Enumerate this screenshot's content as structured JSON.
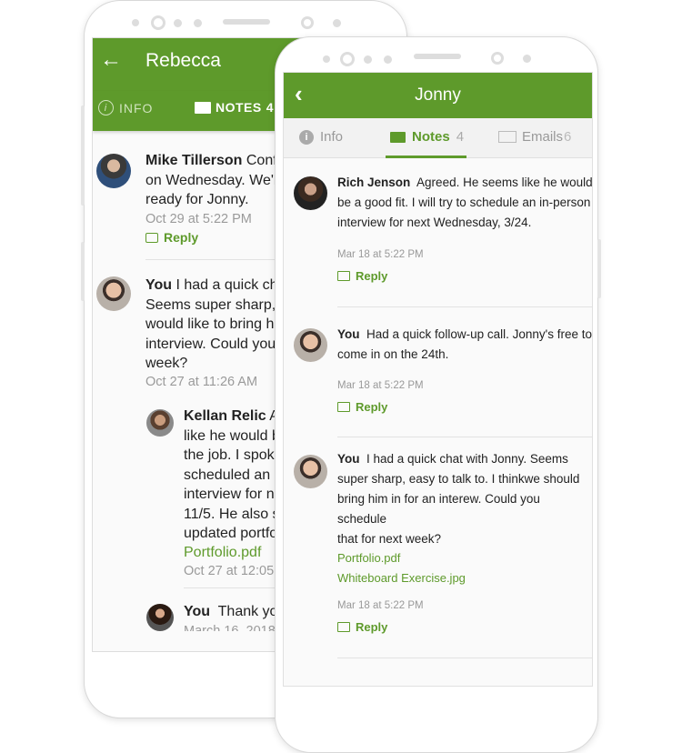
{
  "back_phone": {
    "header": {
      "title": "Rebecca",
      "back_icon": "arrow-left-icon"
    },
    "tabs": [
      {
        "label": "INFO",
        "icon": "info-icon"
      },
      {
        "label": "NOTES",
        "count": "4",
        "icon": "comment-icon",
        "active": true
      }
    ],
    "notes": [
      {
        "author": "Mike Tillerson",
        "lines": [
          "Confi",
          "on Wednesday. We'l",
          "ready for Jonny."
        ],
        "time": "Oct 29 at 5:22 PM",
        "reply": "Reply"
      },
      {
        "author": "You",
        "lines": [
          "I had a quick ch",
          "Seems super sharp,",
          "would like to bring h",
          "interview. Could you",
          "week?"
        ],
        "time": "Oct 27 at 11:26 AM"
      },
      {
        "author": "Kellan Relic",
        "lines": [
          "Ag",
          "like he would b",
          "the job. I spoke",
          "scheduled an i",
          "interview for ne",
          "11/5. He also s",
          "updated portfo"
        ],
        "attachment": "Portfolio.pdf",
        "time": "Oct 27 at 12:05 P"
      },
      {
        "author": "You",
        "lines": [
          "Thank you"
        ],
        "time": "March 16, 2018"
      }
    ]
  },
  "front_phone": {
    "header": {
      "title": "Jonny",
      "back_icon": "chevron-left-icon"
    },
    "tabs": [
      {
        "label": "Info",
        "icon": "info-icon"
      },
      {
        "label": "Notes",
        "count": "4",
        "icon": "comment-icon",
        "active": true
      },
      {
        "label": "Emails",
        "count": "6",
        "icon": "envelope-icon"
      }
    ],
    "notes": [
      {
        "author": "Rich Jenson",
        "lines": [
          "Agreed. He seems like he would",
          "be a good fit. I will try to schedule an in-person",
          "interview for next Wednesday, 3/24."
        ],
        "time": "Mar 18 at 5:22 PM",
        "reply": "Reply"
      },
      {
        "author": "You",
        "lines": [
          "Had a quick follow-up call. Jonny's free to",
          "come in on the 24th."
        ],
        "time": "Mar 18 at 5:22 PM",
        "reply": "Reply"
      },
      {
        "author": "You",
        "lines": [
          "I had a quick chat with Jonny. Seems",
          "super sharp, easy to talk to. I thinkwe should",
          "bring him in for an interew. Could you schedule",
          "that for next week?"
        ],
        "attachments": [
          "Portfolio.pdf",
          "Whiteboard Exercise.jpg"
        ],
        "time": "Mar 18 at 5:22 PM",
        "reply": "Reply"
      }
    ]
  },
  "colors": {
    "brand_green": "#5e9a2b"
  }
}
